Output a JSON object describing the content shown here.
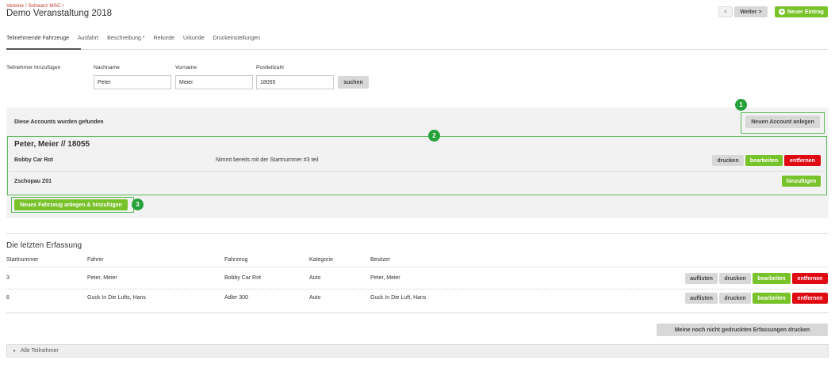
{
  "header": {
    "breadcrumb": "Vereine / Schwarz MSC /",
    "title": "Demo Veranstaltung 2018",
    "prev_label": "<",
    "next_label": "Weiter >",
    "new_entry_label": "Neuer Eintrag"
  },
  "tabs": [
    {
      "label": "Teilnehmende Fahrzeuge"
    },
    {
      "label": "Ausfahrt"
    },
    {
      "label": "Beschreibung *"
    },
    {
      "label": "Rekorde"
    },
    {
      "label": "Urkunde"
    },
    {
      "label": "Druckeinstellungen"
    }
  ],
  "add_participant": {
    "label": "Teilnehmer hinzufügen",
    "lastname_label": "Nachname",
    "firstname_label": "Vorname",
    "zip_label": "Postleitzahl",
    "lastname_value": "Peter",
    "firstname_value": "Meier",
    "zip_value": "18055",
    "search_label": "suchen"
  },
  "found": {
    "heading": "Diese Accounts wurden gefunden",
    "new_account_label": "Neuen Account anlegen",
    "person": "Peter, Meier // 18055",
    "vehicles": [
      {
        "name": "Bobby Car Rot",
        "note": "Nimmt bereits mit der Startnummer #3 teil",
        "print": "drucken",
        "edit": "bearbeiten",
        "remove": "entfernen"
      },
      {
        "name": "Zschopau Z01",
        "add": "hinzufügen"
      }
    ],
    "new_vehicle_label": "Neues Fahrzeug anlegen & hinzufügen"
  },
  "badges": [
    "1",
    "2",
    "3"
  ],
  "recent": {
    "title": "Die letzten Erfassung",
    "columns": [
      "Startnummer",
      "Fahrer",
      "Fahrzeug",
      "Kategorie",
      "Besitzer"
    ],
    "rows": [
      {
        "start": "3",
        "driver": "Peter, Meier",
        "vehicle": "Bobby Car Rot",
        "category": "Auto",
        "owner": "Peter, Meier"
      },
      {
        "start": "6",
        "driver": "Guck In Die Lufts, Hans",
        "vehicle": "Adler 300",
        "category": "Auto",
        "owner": "Guck In Die Luft, Hans"
      }
    ],
    "actions": {
      "list": "auflisten",
      "print": "drucken",
      "edit": "bearbeiten",
      "remove": "entfernen"
    },
    "print_pending_label": "Meine noch nicht gedruckten Erfassungen drucken"
  },
  "accordion": {
    "label": "Alle Teilnehmer"
  },
  "colors": {
    "green": "#78c22a",
    "red": "#e00a13",
    "highlight": "#5cb85c",
    "badge": "#27a13a"
  }
}
